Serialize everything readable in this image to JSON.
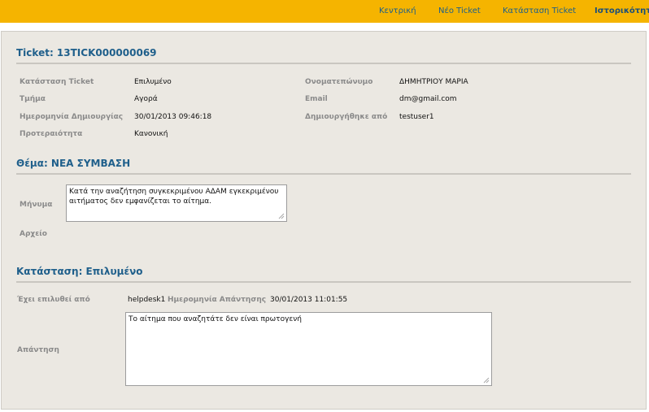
{
  "nav": {
    "home": "Κεντρική",
    "new_ticket": "Νέο Ticket",
    "ticket_status": "Κατάσταση Ticket",
    "history": "Ιστορικότητα"
  },
  "ticket": {
    "title": "Ticket: 13TICK000000069",
    "status_label": "Κατάσταση Ticket",
    "status_value": "Επιλυμένο",
    "dept_label": "Τμήμα",
    "dept_value": "Αγορά",
    "created_label": "Ημερομηνία Δημιουργίας",
    "created_value": "30/01/2013 09:46:18",
    "priority_label": "Προτεραιότητα",
    "priority_value": "Κανονική",
    "name_label": "Ονοματεπώνυμο",
    "name_value": "ΔΗΜΗΤΡΙΟΥ ΜΑΡΙΑ",
    "email_label": "Email",
    "email_value": "dm@gmail.com",
    "creator_label": "Δημιουργήθηκε από",
    "creator_value": "testuser1"
  },
  "subject": {
    "title": "Θέμα: ΝΕΑ ΣΥΜΒΑΣΗ",
    "message_label": "Μήνυμα",
    "message_value": "Κατά την αναζήτηση συγκεκριμένου ΑΔΑΜ εγκεκριμένου αιτήματος δεν εμφανίζεται το αίτημα.",
    "file_label": "Αρχείο"
  },
  "resolution": {
    "title": "Κατάσταση: Επιλυμένο",
    "solved_by_label": "Έχει επιλυθεί από",
    "solved_by_value": "helpdesk1",
    "answer_date_label": "Ημερομηνία Απάντησης",
    "answer_date_value": "30/01/2013 11:01:55",
    "answer_label": "Απάντηση",
    "answer_value": "Το αίτημα που αναζητάτε δεν είναι πρωτογενή"
  },
  "colors": {
    "topbar": "#f5b400",
    "heading": "#1f5f8b",
    "panel": "#ebe8e2"
  }
}
